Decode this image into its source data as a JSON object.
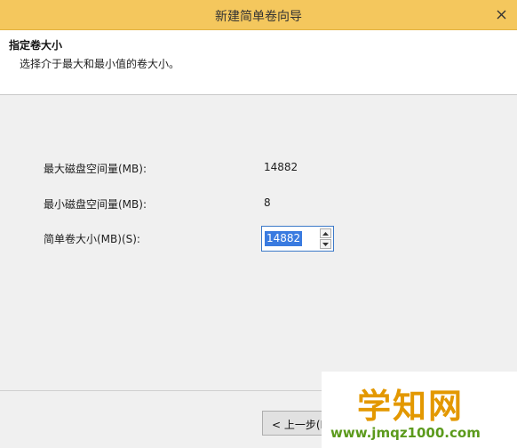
{
  "window": {
    "title": "新建简单卷向导"
  },
  "header": {
    "title": "指定卷大小",
    "subtitle": "选择介于最大和最小值的卷大小。"
  },
  "fields": {
    "max_label": "最大磁盘空间量(MB):",
    "max_value": "14882",
    "min_label": "最小磁盘空间量(MB):",
    "min_value": "8",
    "size_label": "简单卷大小(MB)(S):",
    "size_value": "14882"
  },
  "buttons": {
    "back": "< 上一步(B"
  },
  "watermark": {
    "brand": "学知网",
    "url": "www.jmqz1000.com"
  },
  "colors": {
    "titlebar": "#f4c75d",
    "selection": "#3a7be0",
    "watermark_brand": "#e39800",
    "watermark_url": "#5b9a1c"
  }
}
